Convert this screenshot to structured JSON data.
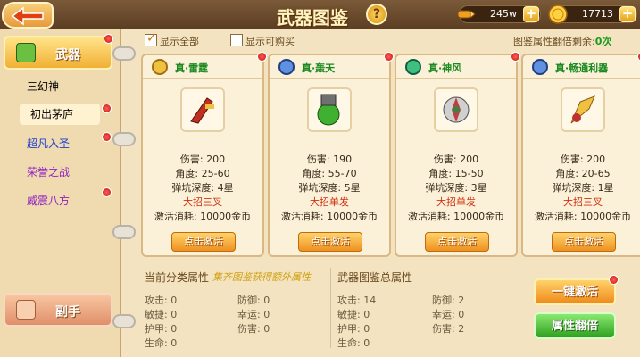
{
  "header": {
    "title": "武器图鉴",
    "currency1": "245w",
    "currency2": "17713"
  },
  "filters": {
    "show_all": "显示全部",
    "show_buyable": "显示可购买",
    "remain_label": "图鉴属性翻倍剩余:",
    "remain_value": "0次"
  },
  "sidebar": {
    "tab_weapon": "武器",
    "tab_secondary": "副手",
    "items": [
      {
        "label": "三幻神",
        "color": "#3a2a1a"
      },
      {
        "label": "初出茅庐",
        "color": "#6a4a20"
      },
      {
        "label": "超凡入圣",
        "color": "#2040d0"
      },
      {
        "label": "荣誉之战",
        "color": "#9020c0"
      },
      {
        "label": "威震八方",
        "color": "#9020c0"
      }
    ]
  },
  "cards": [
    {
      "name": "真·雷霆",
      "damage": "伤害: 200",
      "angle": "角度: 25-60",
      "depth": "弹坑深度: 4星",
      "skill": "大招三叉",
      "cost": "激活消耗: 10000金币",
      "button": "点击激活"
    },
    {
      "name": "真·轰天",
      "damage": "伤害: 190",
      "angle": "角度: 55-70",
      "depth": "弹坑深度: 5星",
      "skill": "大招单发",
      "cost": "激活消耗: 10000金币",
      "button": "点击激活"
    },
    {
      "name": "真·神风",
      "damage": "伤害: 200",
      "angle": "角度: 15-50",
      "depth": "弹坑深度: 3星",
      "skill": "大招单发",
      "cost": "激活消耗: 10000金币",
      "button": "点击激活"
    },
    {
      "name": "真·畅通利器",
      "damage": "伤害: 200",
      "angle": "角度: 20-65",
      "depth": "弹坑深度: 1星",
      "skill": "大招三叉",
      "cost": "激活消耗: 10000金币",
      "button": "点击激活"
    }
  ],
  "attributes": {
    "current_title": "当前分类属性",
    "current_note": "集齐图鉴获得额外属性",
    "total_title": "武器图鉴总属性",
    "current": {
      "attack": "攻击: 0",
      "agility": "敏捷: 0",
      "armor": "护甲: 0",
      "life": "生命: 0",
      "defense": "防御: 0",
      "luck": "幸运: 0",
      "damage": "伤害: 0"
    },
    "total": {
      "attack": "攻击: 14",
      "agility": "敏捷: 0",
      "armor": "护甲: 0",
      "life": "生命: 0",
      "defense": "防御: 2",
      "luck": "幸运: 0",
      "damage": "伤害: 2"
    }
  },
  "buttons": {
    "one_click": "一键激活",
    "double": "属性翻倍"
  }
}
